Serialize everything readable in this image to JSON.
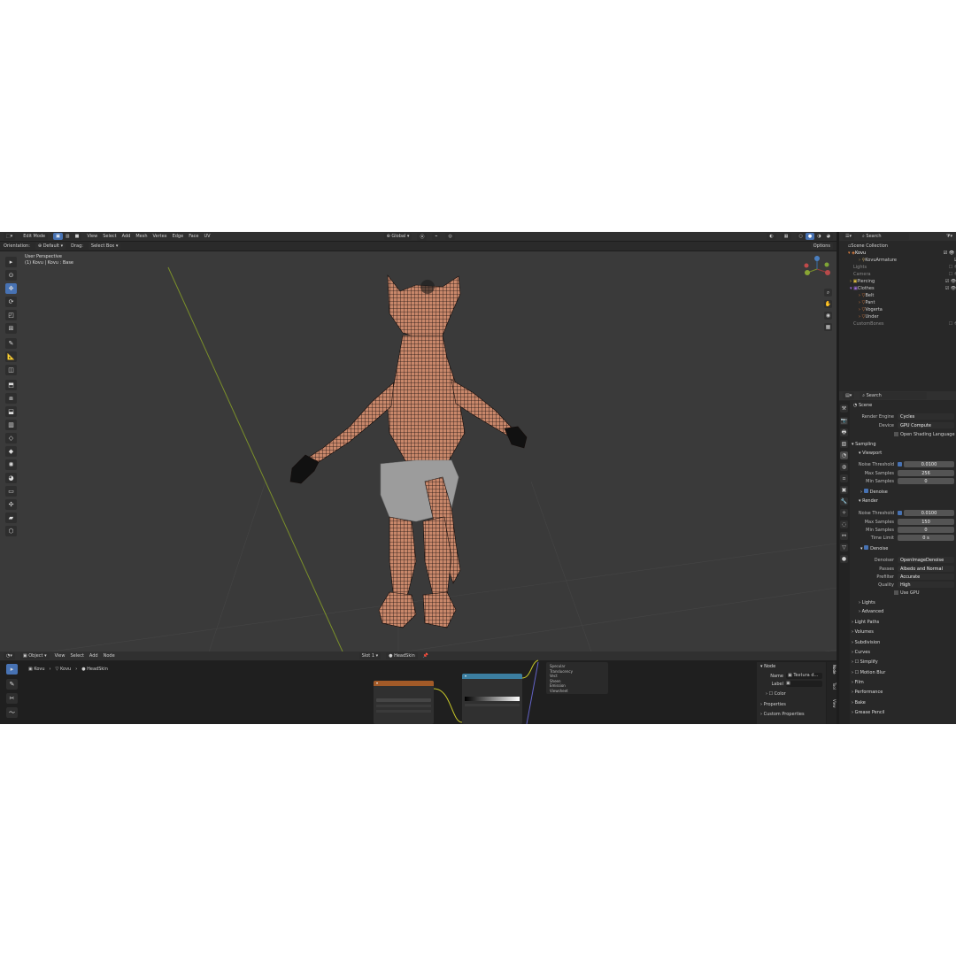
{
  "viewport_header": {
    "mode": "Edit Mode",
    "menus": [
      "View",
      "Select",
      "Add",
      "Mesh",
      "Vertex",
      "Edge",
      "Face",
      "UV"
    ],
    "transform": "Global",
    "options": "Options"
  },
  "tool_header": {
    "orientation_label": "Orientation:",
    "orientation_value": "Default",
    "drag_label": "Drag:",
    "drag_value": "Select Box"
  },
  "viewport": {
    "perspective": "User Perspective",
    "object_info": "(1) Kovu | Kovu : Base",
    "colors": {
      "background": "#3a3a3a",
      "x_axis": "#9b3a3a",
      "y_axis": "#7a8f2a",
      "skin": "#c28468",
      "shorts": "#9c9c9c"
    }
  },
  "outliner": {
    "title": "Scene Collection",
    "search_placeholder": "Search",
    "items": [
      {
        "label": "Kovu"
      },
      {
        "label": "KovuArmature"
      },
      {
        "label": "Lights"
      },
      {
        "label": "Camera"
      },
      {
        "label": "Piercing"
      },
      {
        "label": "Clothes"
      },
      {
        "label": "Belt"
      },
      {
        "label": "Pant"
      },
      {
        "label": "Vogerta"
      },
      {
        "label": "Under"
      },
      {
        "label": "CustomBones"
      }
    ]
  },
  "properties": {
    "search_placeholder": "Search",
    "breadcrumb": "Scene",
    "render_engine_label": "Render Engine",
    "render_engine": "Cycles",
    "device_label": "Device",
    "device": "GPU Compute",
    "osl": "Open Shading Language",
    "sampling": "Sampling",
    "viewport_sec": "Viewport",
    "noise_threshold_label": "Noise Threshold",
    "vp_noise_threshold": "0.0100",
    "max_samples_label": "Max Samples",
    "vp_max_samples": "256",
    "min_samples_label": "Min Samples",
    "vp_min_samples": "0",
    "denoise": "Denoise",
    "render_sec": "Render",
    "r_noise_threshold": "0.0100",
    "r_max_samples": "150",
    "r_min_samples": "0",
    "time_limit_label": "Time Limit",
    "time_limit": "0 s",
    "denoiser_label": "Denoiser",
    "denoiser": "OpenImageDenoise",
    "passes_label": "Passes",
    "passes": "Albedo and Normal",
    "prefilter_label": "Prefilter",
    "prefilter": "Accurate",
    "quality_label": "Quality",
    "quality": "High",
    "use_gpu": "Use GPU",
    "lights": "Lights",
    "advanced": "Advanced",
    "sections": [
      "Light Paths",
      "Volumes",
      "Subdivision",
      "Curves",
      "Simplify",
      "Motion Blur",
      "Film",
      "Performance",
      "Bake",
      "Grease Pencil"
    ]
  },
  "node_editor": {
    "object_mode": "Object",
    "menus": [
      "View",
      "Select",
      "Add",
      "Node"
    ],
    "slot": "Slot 1",
    "material": "HeadSkin",
    "breadcrumb": [
      "Kovu",
      "Kovu",
      "HeadSkin"
    ],
    "sidebar_title": "Node",
    "name_label": "Name",
    "name_value": "Textura d...",
    "label_label": "Label",
    "color": "Color",
    "properties": "Properties",
    "custom_properties": "Custom Properties",
    "tabs": [
      "Node",
      "Tool",
      "View"
    ],
    "list_items": [
      "Specular",
      "Translucency",
      "Vect",
      "Sheen",
      "Emission",
      "Viewsheet"
    ]
  }
}
